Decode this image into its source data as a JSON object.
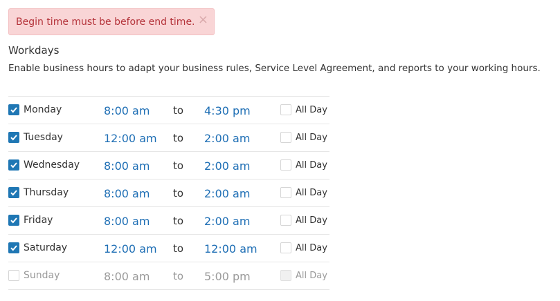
{
  "alert": {
    "message": "Begin time must be before end time.",
    "close_glyph": "×"
  },
  "workdays": {
    "title": "Workdays",
    "description": "Enable business hours to adapt your business rules, Service Level Agreement, and reports to your working hours.",
    "to_label": "to",
    "all_day_label": "All Day",
    "days": [
      {
        "name": "Monday",
        "enabled": true,
        "start": "8:00 am",
        "end": "4:30 pm",
        "all_day": false
      },
      {
        "name": "Tuesday",
        "enabled": true,
        "start": "12:00 am",
        "end": "2:00 am",
        "all_day": false
      },
      {
        "name": "Wednesday",
        "enabled": true,
        "start": "8:00 am",
        "end": "2:00 am",
        "all_day": false
      },
      {
        "name": "Thursday",
        "enabled": true,
        "start": "8:00 am",
        "end": "2:00 am",
        "all_day": false
      },
      {
        "name": "Friday",
        "enabled": true,
        "start": "8:00 am",
        "end": "2:00 am",
        "all_day": false
      },
      {
        "name": "Saturday",
        "enabled": true,
        "start": "12:00 am",
        "end": "12:00 am",
        "all_day": false
      },
      {
        "name": "Sunday",
        "enabled": false,
        "start": "8:00 am",
        "end": "5:00 pm",
        "all_day": false
      }
    ]
  },
  "colors": {
    "accent": "#1f77b4",
    "time_link": "#1f6fb5",
    "alert_bg": "#f9d5d6",
    "alert_text": "#b4333a"
  }
}
